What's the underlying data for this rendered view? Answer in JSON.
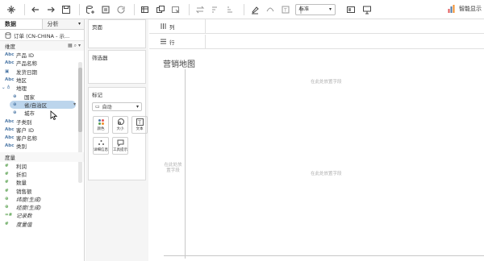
{
  "toolbar": {
    "icons": [
      "tableau-icon",
      "undo-icon",
      "redo-icon",
      "save-icon",
      "new-datasource-icon",
      "pause-icon",
      "refresh-icon",
      "new-sheet-icon",
      "duplicate-icon",
      "clear-icon",
      "swap-icon",
      "sort-asc-icon",
      "sort-desc-icon",
      "highlight-icon",
      "group-icon",
      "label-icon",
      "pin-icon",
      "fit-icon",
      "presentation-icon"
    ],
    "fit_select": "标准",
    "smart_show": "智能显示"
  },
  "left_pane": {
    "tab_data": "数据",
    "tab_analysis": "分析",
    "datasource": "订单 (CN-CHINA - 示...",
    "dimensions_header": "维度",
    "dimensions": [
      {
        "label": "产品 ID",
        "type": "Abc"
      },
      {
        "label": "产品名称",
        "type": "Abc"
      },
      {
        "label": "发货日期",
        "type": "date"
      },
      {
        "label": "地区",
        "type": "Abc"
      },
      {
        "label": "地理",
        "type": "hierarchy"
      },
      {
        "label": "国家",
        "type": "geo"
      },
      {
        "label": "省/自治区",
        "type": "geo"
      },
      {
        "label": "城市",
        "type": "geo"
      },
      {
        "label": "子类别",
        "type": "Abc"
      },
      {
        "label": "客户 ID",
        "type": "Abc"
      },
      {
        "label": "客户名称",
        "type": "Abc"
      },
      {
        "label": "类别",
        "type": "Abc"
      }
    ],
    "measures_header": "度量",
    "measures": [
      {
        "label": "利润",
        "type": "measure",
        "italic": false
      },
      {
        "label": "折扣",
        "type": "measure",
        "italic": false
      },
      {
        "label": "数量",
        "type": "measure",
        "italic": false
      },
      {
        "label": "销售额",
        "type": "measure",
        "italic": false
      },
      {
        "label": "纬度(生成)",
        "type": "geo",
        "italic": true
      },
      {
        "label": "经度(生成)",
        "type": "geo",
        "italic": true
      },
      {
        "label": "记录数",
        "type": "measure",
        "italic": true
      },
      {
        "label": "度量值",
        "type": "measure",
        "italic": true
      }
    ]
  },
  "pages_card": {
    "title": "页面"
  },
  "filters_card": {
    "title": "筛选器"
  },
  "marks_card": {
    "title": "标记",
    "mark_type": "自动",
    "buttons": [
      {
        "label": "颜色",
        "icon": "color-icon"
      },
      {
        "label": "大小",
        "icon": "size-icon"
      },
      {
        "label": "文本",
        "icon": "text-icon"
      },
      {
        "label": "详细信息",
        "icon": "detail-icon"
      },
      {
        "label": "工具提示",
        "icon": "tooltip-icon"
      }
    ]
  },
  "shelves": {
    "columns": "列",
    "rows": "行"
  },
  "view": {
    "title": "营销地图",
    "drop_field_top": "在此处放置字段",
    "drop_field_left": "在此处放置字段",
    "drop_field_center": "在此处放置字段"
  },
  "colors": {
    "accent": "#4e79a7",
    "geo": "#59a14f",
    "highlight": "#bcd5ec"
  }
}
